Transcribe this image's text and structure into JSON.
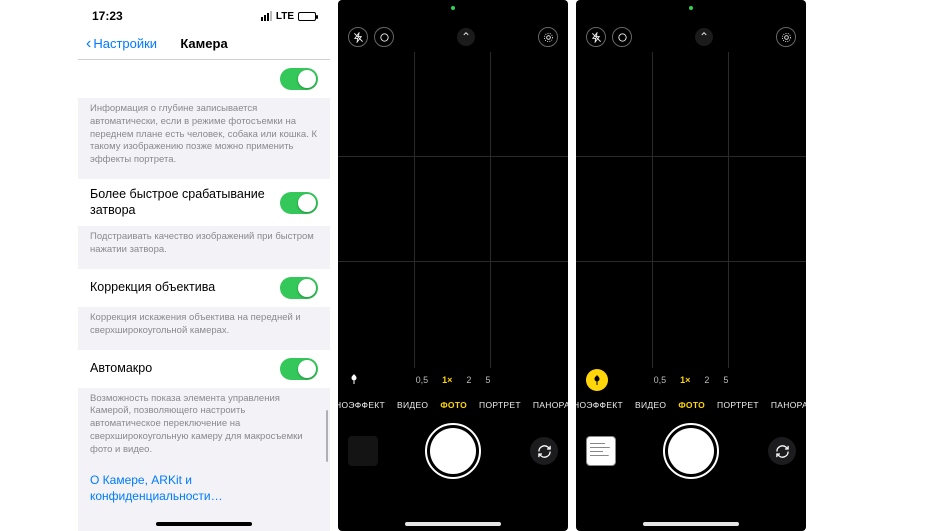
{
  "settings": {
    "status": {
      "time": "17:23",
      "net": "LTE"
    },
    "nav": {
      "back": "Настройки",
      "title": "Камера"
    },
    "rows": {
      "depth_footer": "Информация о глубине записывается автоматически, если в режиме фотосъемки на переднем плане есть человек, собака или кошка. К такому изображению позже можно применить эффекты портрета.",
      "faster_shutter": "Более быстрое срабатывание затвора",
      "faster_shutter_footer": "Подстраивать качество изображений при быстром нажатии затвора.",
      "lens_correction": "Коррекция объектива",
      "lens_correction_footer": "Коррекция искажения объектива на передней и сверхширокоугольной камерах.",
      "automacro": "Автомакро",
      "automacro_footer": "Возможность показа элемента управления Камерой, позволяющего настроить автоматическое переключение на сверхширокоугольную камеру для макросъемки фото и видео.",
      "about_link": "О Камере, ARKit и конфиденциальности…"
    }
  },
  "camera": {
    "zooms": {
      "z05": "0,5",
      "z1": "1×",
      "z2": "2",
      "z5": "5"
    },
    "modes": {
      "kino": "ИНОЭФФЕКТ",
      "video": "ВИДЕО",
      "photo": "ФОТО",
      "portrait": "ПОРТРЕТ",
      "pano": "ПАНОРАМ"
    }
  }
}
